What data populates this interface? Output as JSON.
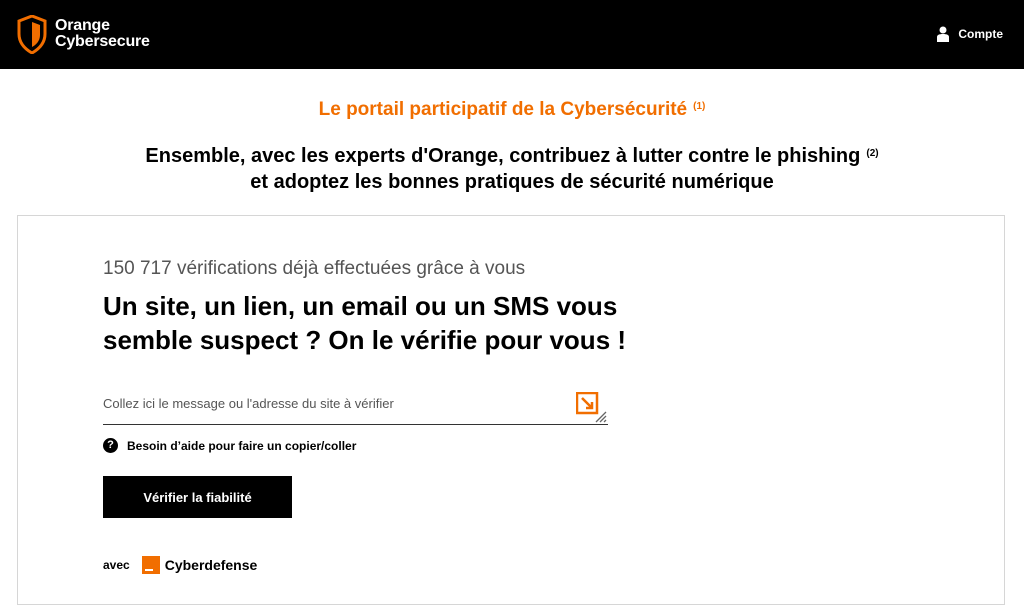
{
  "header": {
    "brand_line1": "Orange",
    "brand_line2": "Cybersecure",
    "account_label": "Compte",
    "logo_icon": "shield-icon",
    "account_icon": "user-icon"
  },
  "hero": {
    "portal_title": "Le portail participatif de la Cybersécurité",
    "portal_note": "(1)",
    "tagline_line1": "Ensemble, avec les experts d'Orange, contribuez à lutter contre le phishing",
    "tagline_note": "(2)",
    "tagline_line2": "et adoptez les bonnes pratiques de sécurité numérique"
  },
  "check": {
    "counter": "150 717 vérifications déjà effectuées grâce à vous",
    "question_line1": "Un site, un lien, un email ou un SMS vous",
    "question_line2": "semble suspect ? On le vérifie pour vous !",
    "input_value": "",
    "input_placeholder": "Collez ici le message ou l'adresse du site à vérifier",
    "help_glyph": "?",
    "help_text": "Besoin d’aide pour faire un copier/coller",
    "verify_label": "Vérifier la fiabilité",
    "partner_prefix": "avec",
    "partner_name": "Cyberdefense"
  },
  "colors": {
    "brand_orange": "#f16e00",
    "header_bg": "#000000"
  }
}
